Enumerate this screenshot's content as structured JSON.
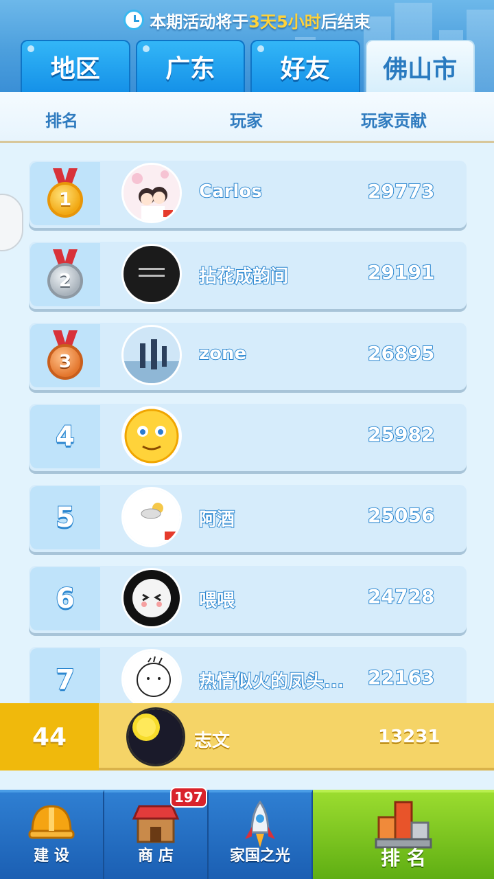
{
  "banner": {
    "prefix": "本期活动将于",
    "highlight": "3天5小时",
    "suffix": "后结束"
  },
  "tabs": [
    {
      "label": "地区",
      "active": false
    },
    {
      "label": "广东",
      "active": false
    },
    {
      "label": "好友",
      "active": false
    },
    {
      "label": "佛山市",
      "active": true
    }
  ],
  "columns": {
    "rank": "排名",
    "player": "玩家",
    "contribution": "玩家贡献"
  },
  "leaderboard": [
    {
      "rank": "1",
      "name": "Carlos",
      "score": "29773",
      "medal": "gold"
    },
    {
      "rank": "2",
      "name": "拈花成韵间",
      "score": "29191",
      "medal": "silver"
    },
    {
      "rank": "3",
      "name": "zone",
      "score": "26895",
      "medal": "bronze"
    },
    {
      "rank": "4",
      "name": "",
      "score": "25982",
      "medal": ""
    },
    {
      "rank": "5",
      "name": "阿酒",
      "score": "25056",
      "medal": ""
    },
    {
      "rank": "6",
      "name": "喂喂",
      "score": "24728",
      "medal": ""
    },
    {
      "rank": "7",
      "name": "热情似火的凤头...",
      "score": "22163",
      "medal": ""
    }
  ],
  "my_entry": {
    "rank": "44",
    "name": "志文",
    "score": "13231"
  },
  "nav": {
    "build": {
      "label": "建 设",
      "icon": "hardhat-icon"
    },
    "shop": {
      "label": "商 店",
      "icon": "shop-icon",
      "badge": "197"
    },
    "homeland": {
      "label": "家国之光",
      "icon": "rocket-icon"
    },
    "ranking": {
      "label": "排 名",
      "icon": "podium-icon"
    }
  },
  "colors": {
    "accent": "#2b86cf",
    "highlight": "#ffd23a",
    "active_nav": "#7cc81f",
    "my_row": "#f5d467"
  }
}
